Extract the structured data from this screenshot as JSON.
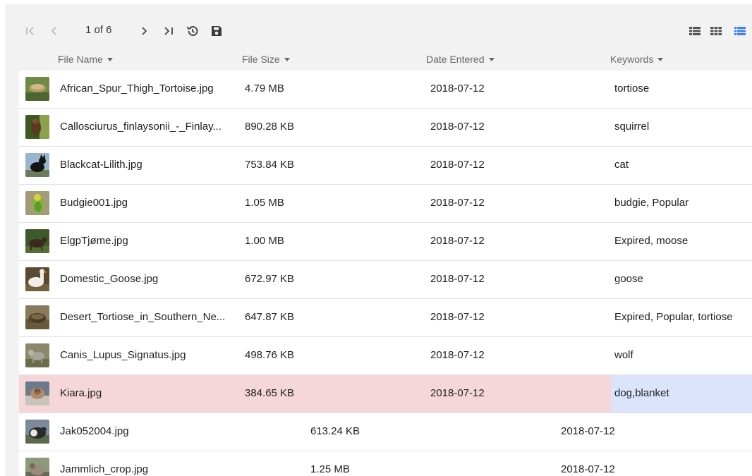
{
  "toolbar": {
    "page_indicator": "1 of 6",
    "icons": [
      "first-page-icon",
      "previous-page-icon",
      "next-page-icon",
      "last-page-icon",
      "history-icon",
      "save-icon",
      "compact-list-view-icon",
      "grid-view-icon",
      "list-view-icon"
    ],
    "active_view_color": "#3b82f6"
  },
  "columns": [
    {
      "label": "File Name"
    },
    {
      "label": "File Size"
    },
    {
      "label": "Date Entered"
    },
    {
      "label": "Keywords"
    }
  ],
  "rows": [
    {
      "name": "African_Spur_Thigh_Tortoise.jpg",
      "size": "4.79 MB",
      "date": "2018-07-12",
      "keywords": "tortiose"
    },
    {
      "name": "Callosciurus_finlaysonii_-_Finlay...",
      "size": "890.28 KB",
      "date": "2018-07-12",
      "keywords": "squirrel"
    },
    {
      "name": "Blackcat-Lilith.jpg",
      "size": "753.84 KB",
      "date": "2018-07-12",
      "keywords": "cat"
    },
    {
      "name": "Budgie001.jpg",
      "size": "1.05 MB",
      "date": "2018-07-12",
      "keywords": "budgie, Popular"
    },
    {
      "name": "ElgpTjøme.jpg",
      "size": "1.00 MB",
      "date": "2018-07-12",
      "keywords": "Expired, moose"
    },
    {
      "name": "Domestic_Goose.jpg",
      "size": "672.97 KB",
      "date": "2018-07-12",
      "keywords": "goose"
    },
    {
      "name": "Desert_Tortiose_in_Southern_Ne...",
      "size": "647.87 KB",
      "date": "2018-07-12",
      "keywords": "Expired, Popular, tortiose"
    },
    {
      "name": "Canis_Lupus_Signatus.jpg",
      "size": "498.76 KB",
      "date": "2018-07-12",
      "keywords": "wolf"
    },
    {
      "name": "Kiara.jpg",
      "size": "384.65 KB",
      "date": "2018-07-12",
      "keywords": "dog,blanket"
    },
    {
      "name": "Jak052004.jpg",
      "size": "613.24 KB",
      "date": "2018-07-12",
      "keywords": ""
    },
    {
      "name": "Jammlich_crop.jpg",
      "size": "1.25 MB",
      "date": "2018-07-12",
      "keywords": ""
    }
  ],
  "selection": {
    "selected_row_color": "#f5d7d9",
    "keyword_highlight_color": "#dce4fb"
  }
}
